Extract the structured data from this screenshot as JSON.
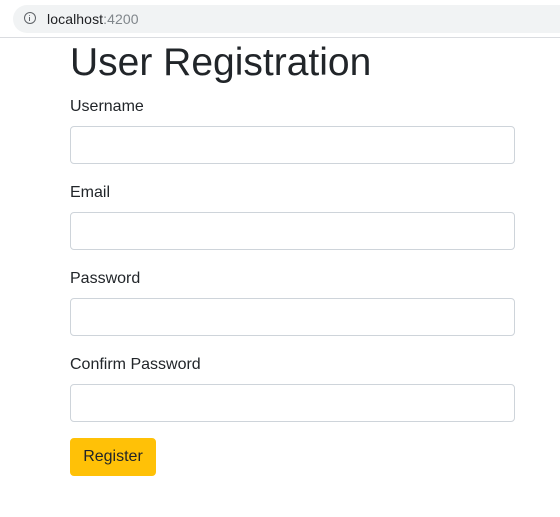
{
  "browser": {
    "url_host": "localhost",
    "url_port": ":4200"
  },
  "page": {
    "title": "User Registration"
  },
  "form": {
    "fields": [
      {
        "label": "Username",
        "value": "",
        "placeholder": ""
      },
      {
        "label": "Email",
        "value": "",
        "placeholder": ""
      },
      {
        "label": "Password",
        "value": "",
        "placeholder": ""
      },
      {
        "label": "Confirm Password",
        "value": "",
        "placeholder": ""
      }
    ],
    "submit_label": "Register"
  },
  "colors": {
    "accent": "#ffc107",
    "input_border": "#ced4da",
    "text": "#212529"
  },
  "icons": {
    "address_bar": "info-icon"
  }
}
